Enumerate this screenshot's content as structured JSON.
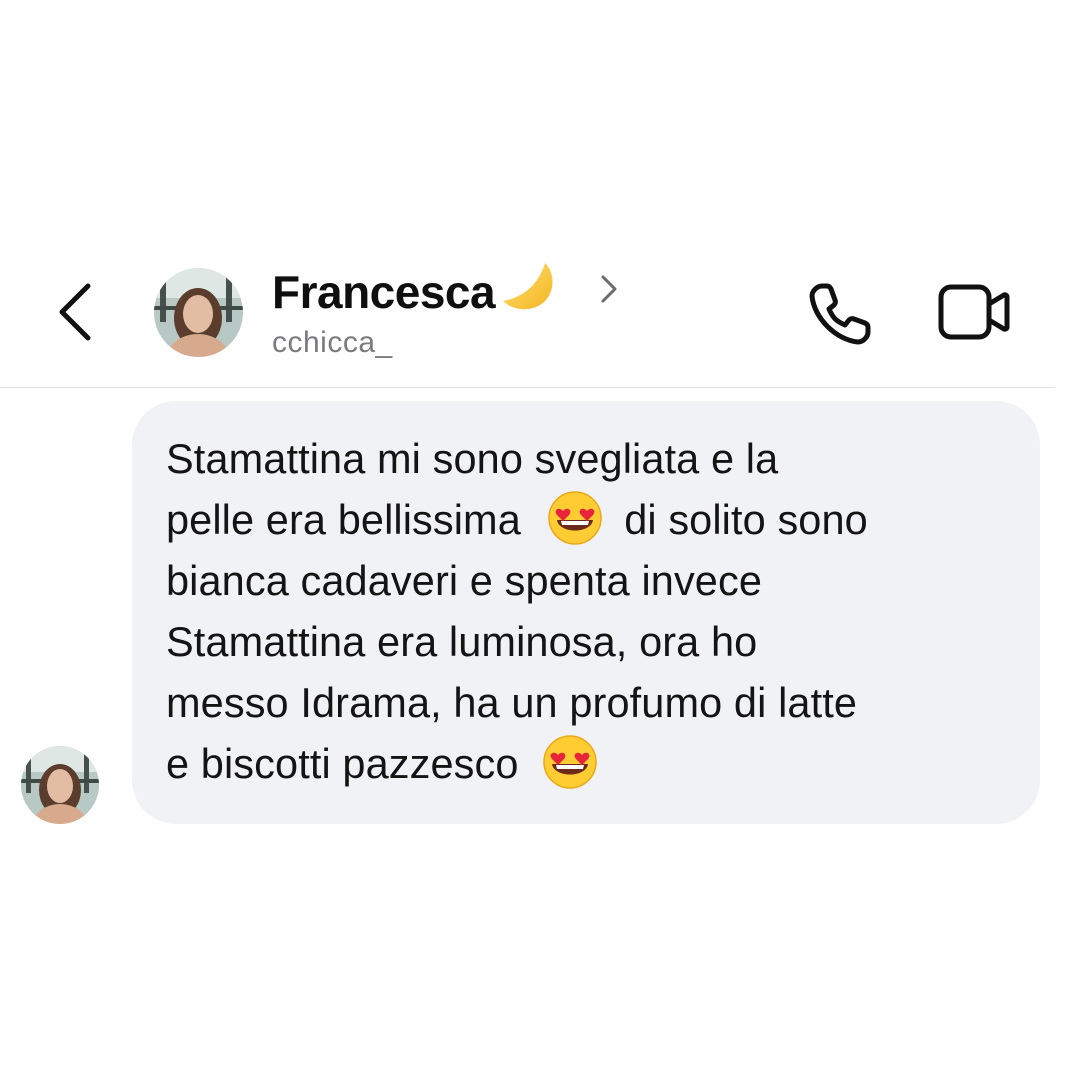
{
  "header": {
    "contact_name": "Francesca",
    "name_emoji": "crescent-moon-icon",
    "username": "cchicca_",
    "back_icon": "chevron-left-icon",
    "profile_chevron_icon": "chevron-right-icon",
    "call_icon": "phone-icon",
    "video_icon": "video-camera-icon"
  },
  "message": {
    "lines": [
      "Stamattina mi sono svegliata e la",
      "pelle era bellissima",
      "di solito sono",
      "bianca cadaveri e spenta invece",
      "Stamattina era luminosa, ora ho",
      "messo Idrama, ha un profumo di latte",
      "e biscotti pazzesco"
    ],
    "emoji": "heart-eyes-emoji-icon"
  },
  "colors": {
    "bubble_bg": "#f1f2f5",
    "text": "#141414",
    "username": "#7a7a80",
    "divider": "#e3e3e6"
  }
}
